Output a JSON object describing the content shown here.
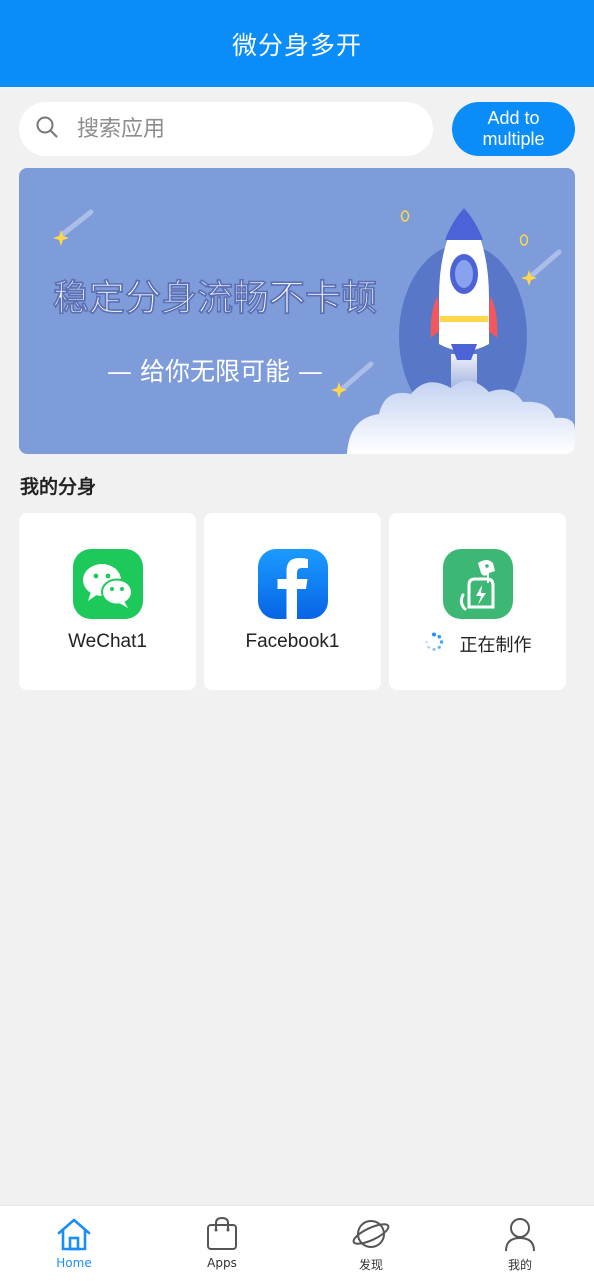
{
  "header": {
    "title": "微分身多开"
  },
  "search": {
    "placeholder": "搜索应用",
    "value": ""
  },
  "add_button": {
    "label": "Add to multiple"
  },
  "banner": {
    "headline": "稳定分身流畅不卡顿",
    "subline": "— 给你无限可能 —"
  },
  "section": {
    "title": "我的分身"
  },
  "apps": [
    {
      "label": "WeChat1",
      "icon": "wechat-icon"
    },
    {
      "label": "Facebook1",
      "icon": "facebook-icon"
    },
    {
      "label": "正在制作",
      "icon": "clone-maker-icon",
      "status": "loading"
    }
  ],
  "nav": {
    "items": [
      {
        "label": "Home",
        "icon": "home-icon",
        "active": true
      },
      {
        "label": "Apps",
        "icon": "shopping-bag-icon",
        "active": false
      },
      {
        "label": "发现",
        "icon": "planet-icon",
        "active": false
      },
      {
        "label": "我的",
        "icon": "user-icon",
        "active": false
      }
    ]
  },
  "colors": {
    "primary": "#0a8cf9",
    "background": "#f1f1f1",
    "banner": "#7f9cda",
    "wechat_green": "#1ec95b",
    "facebook_blue": "#1877f2",
    "maker_green": "#3db874"
  }
}
